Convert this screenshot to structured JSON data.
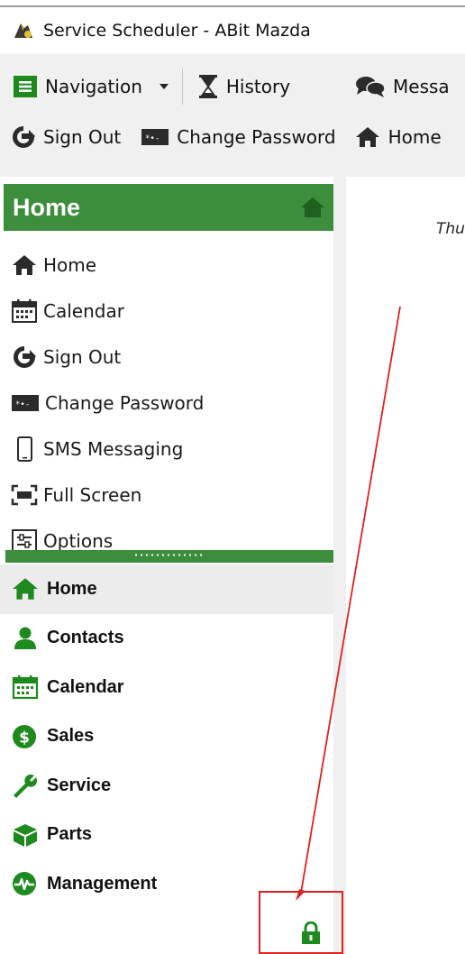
{
  "window": {
    "title": "Service Scheduler - ABit Mazda",
    "icon": "app-logo-icon"
  },
  "toolbar": {
    "row1": [
      {
        "label": "Navigation",
        "icon": "navigation-icon",
        "dropdown": true
      },
      {
        "label": "History",
        "icon": "hourglass-icon"
      },
      {
        "label": "Messa",
        "icon": "messages-icon"
      }
    ],
    "row2": [
      {
        "label": "Sign Out",
        "icon": "sign-out-icon"
      },
      {
        "label": "Change Password",
        "icon": "password-icon"
      },
      {
        "label": "Home",
        "icon": "home-icon"
      }
    ]
  },
  "panel": {
    "header": "Home",
    "items": [
      {
        "label": "Home",
        "icon": "home-icon"
      },
      {
        "label": "Calendar",
        "icon": "calendar-icon"
      },
      {
        "label": "Sign Out",
        "icon": "sign-out-icon"
      },
      {
        "label": "Change Password",
        "icon": "password-icon"
      },
      {
        "label": "SMS Messaging",
        "icon": "phone-icon"
      },
      {
        "label": "Full Screen",
        "icon": "full-screen-icon"
      },
      {
        "label": "Options",
        "icon": "options-icon"
      }
    ],
    "modules": [
      {
        "label": "Home",
        "icon": "home-icon",
        "active": true
      },
      {
        "label": "Contacts",
        "icon": "contacts-icon"
      },
      {
        "label": "Calendar",
        "icon": "calendar-icon"
      },
      {
        "label": "Sales",
        "icon": "sales-icon"
      },
      {
        "label": "Service",
        "icon": "wrench-icon"
      },
      {
        "label": "Parts",
        "icon": "parts-icon"
      },
      {
        "label": "Management",
        "icon": "management-icon"
      }
    ]
  },
  "content": {
    "date_fragment": "Thu"
  },
  "colors": {
    "brand_green": "#3c8d3c",
    "icon_green": "#1e8a1e",
    "annotation_red": "#e0201f"
  }
}
